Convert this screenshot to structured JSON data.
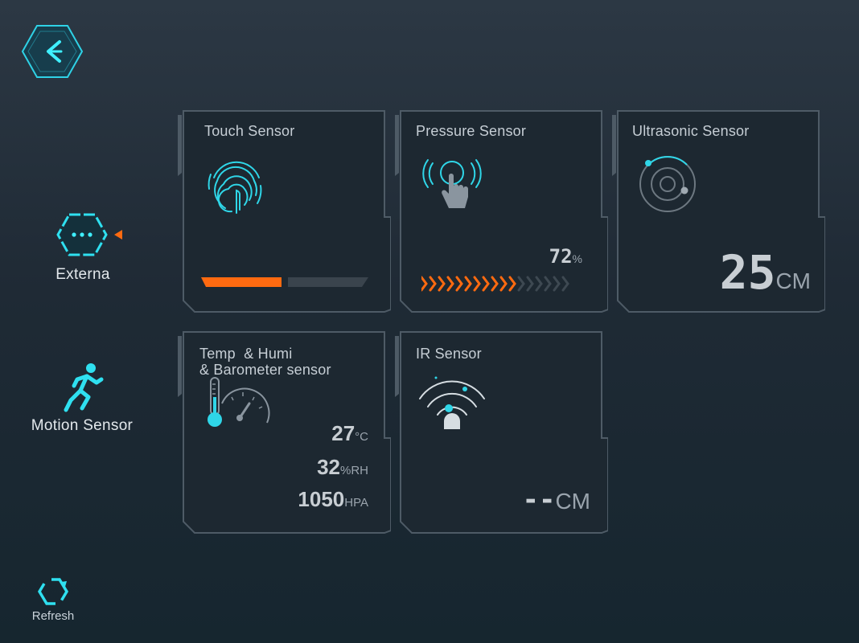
{
  "nav": {
    "externa_label": "Externa",
    "motion_label": "Motion Sensor",
    "refresh_label": "Refresh"
  },
  "colors": {
    "accent_cyan": "#2fe0f0",
    "accent_orange": "#ff6a10",
    "card_bg": "#1d2831",
    "card_border": "#4e5b66"
  },
  "cards": {
    "touch": {
      "title": "Touch Sensor",
      "level": 0.48
    },
    "pressure": {
      "title": "Pressure Sensor",
      "value": "72",
      "unit": "%",
      "filled_chevrons": 11,
      "total_chevrons": 17
    },
    "ultrasonic": {
      "title": "Ultrasonic Sensor",
      "value": "25",
      "unit": "CM"
    },
    "temp": {
      "title_line1": "Temp  & Humi",
      "title_line2": "& Barometer sensor",
      "temperature": "27",
      "temperature_unit": "°C",
      "humidity": "32",
      "humidity_unit": "%RH",
      "pressure": "1050",
      "pressure_unit": "HPA"
    },
    "ir": {
      "title": "IR Sensor",
      "value": "--",
      "unit": "CM"
    }
  },
  "icons": {
    "back": "back-arrow-icon",
    "externa": "hexagon-dots-icon",
    "motion": "running-person-icon",
    "refresh": "refresh-icon"
  }
}
